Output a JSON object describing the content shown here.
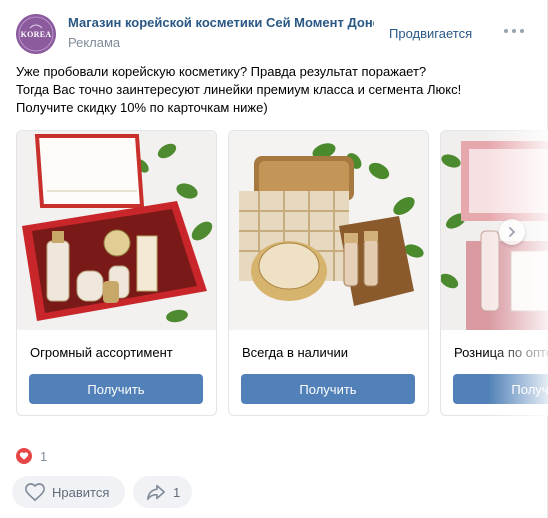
{
  "post": {
    "author": "Магазин корейской косметики Сей Момент Донецк",
    "ad_label": "Реклама",
    "promoted_label": "Продвигается",
    "avatar_text": "KOREA",
    "text_lines": [
      "Уже пробовали корейскую косметику? Правда результат поражает?",
      "Тогда Вас точно заинтересуют линейки премиум класса и сегмента Люкс!",
      "Получите скидку 10% по карточкам ниже)"
    ]
  },
  "carousel": {
    "cards": [
      {
        "title": "Огромный ассортимент",
        "button": "Получить"
      },
      {
        "title": "Всегда в наличии",
        "button": "Получить"
      },
      {
        "title": "Розница по оптовым ценам",
        "button": "Получить"
      }
    ]
  },
  "footer": {
    "likes_count": "1",
    "like_label": "Нравится",
    "share_count": "1"
  },
  "colors": {
    "link": "#2a5885",
    "button": "#5181b8",
    "heart": "#e64646"
  }
}
